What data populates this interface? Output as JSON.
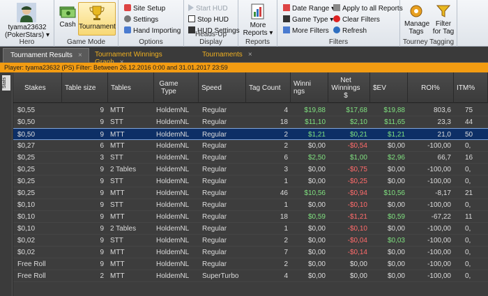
{
  "ribbon": {
    "hero": {
      "name": "tyama23632",
      "site": "(PokerStars)",
      "group_label": "Hero"
    },
    "game_mode": {
      "cash_label": "Cash",
      "tournament_label": "Tournament",
      "group_label": "Game Mode"
    },
    "options": {
      "site_setup": "Site Setup",
      "settings": "Settings",
      "hand_importing": "Hand Importing",
      "group_label": "Options"
    },
    "hud": {
      "start_hud": "Start HUD",
      "stop_hud": "Stop HUD",
      "hud_settings": "HUD Settings",
      "group_label": "Heads-Up Display"
    },
    "reports": {
      "more_reports": "More Reports",
      "group_label": "Reports"
    },
    "filters": {
      "date_range": "Date Range",
      "game_type": "Game Type",
      "more_filters": "More Filters",
      "apply_all": "Apply to all Reports",
      "clear_filters": "Clear Filters",
      "refresh": "Refresh",
      "group_label": "Filters"
    },
    "tagging": {
      "manage_tags": "Manage Tags",
      "filter_for_tag": "Filter for Tag",
      "group_label": "Tourney Tagging"
    }
  },
  "tabs": [
    {
      "label": "Tournament Results"
    },
    {
      "label": "Tournament Winnings Graph"
    },
    {
      "label": "Tournaments"
    }
  ],
  "filter_bar": "Player: tyama23632 (PS)  Filter: Between 26.12.2016 0:00 and 31.01.2017 23:59",
  "side_tab": "Stats",
  "columns": [
    "Stakes",
    "Table size",
    "Tables",
    "Game Type",
    "Speed",
    "Tag Count",
    "Winnings",
    "Net Winnings $",
    "$EV",
    "ROI%",
    "ITM%"
  ],
  "rows": [
    {
      "stakes": "$0,55",
      "size": "9",
      "tables": "MTT",
      "game": "HoldemNL",
      "speed": "Regular",
      "tags": "4",
      "win": "$19,88",
      "net": "$17,68",
      "ev": "$19,88",
      "roi": "803,6",
      "itm": "75"
    },
    {
      "stakes": "$0,50",
      "size": "9",
      "tables": "STT",
      "game": "HoldemNL",
      "speed": "Regular",
      "tags": "18",
      "win": "$11,10",
      "net": "$2,10",
      "ev": "$11,65",
      "roi": "23,3",
      "itm": "44"
    },
    {
      "stakes": "$0,50",
      "size": "9",
      "tables": "MTT",
      "game": "HoldemNL",
      "speed": "Regular",
      "tags": "2",
      "win": "$1,21",
      "net": "$0,21",
      "ev": "$1,21",
      "roi": "21,0",
      "itm": "50"
    },
    {
      "stakes": "$0,27",
      "size": "6",
      "tables": "MTT",
      "game": "HoldemNL",
      "speed": "Regular",
      "tags": "2",
      "win": "$0,00",
      "net": "-$0,54",
      "ev": "$0,00",
      "roi": "-100,00",
      "itm": "0,"
    },
    {
      "stakes": "$0,25",
      "size": "3",
      "tables": "STT",
      "game": "HoldemNL",
      "speed": "Regular",
      "tags": "6",
      "win": "$2,50",
      "net": "$1,00",
      "ev": "$2,96",
      "roi": "66,7",
      "itm": "16"
    },
    {
      "stakes": "$0,25",
      "size": "9",
      "tables": "2 Tables",
      "game": "HoldemNL",
      "speed": "Regular",
      "tags": "3",
      "win": "$0,00",
      "net": "-$0,75",
      "ev": "$0,00",
      "roi": "-100,00",
      "itm": "0,"
    },
    {
      "stakes": "$0,25",
      "size": "9",
      "tables": "STT",
      "game": "HoldemNL",
      "speed": "Regular",
      "tags": "1",
      "win": "$0,00",
      "net": "-$0,25",
      "ev": "$0,00",
      "roi": "-100,00",
      "itm": "0,"
    },
    {
      "stakes": "$0,25",
      "size": "9",
      "tables": "MTT",
      "game": "HoldemNL",
      "speed": "Regular",
      "tags": "46",
      "win": "$10,56",
      "net": "-$0,94",
      "ev": "$10,56",
      "roi": "-8,17",
      "itm": "21"
    },
    {
      "stakes": "$0,10",
      "size": "9",
      "tables": "STT",
      "game": "HoldemNL",
      "speed": "Regular",
      "tags": "1",
      "win": "$0,00",
      "net": "-$0,10",
      "ev": "$0,00",
      "roi": "-100,00",
      "itm": "0,"
    },
    {
      "stakes": "$0,10",
      "size": "9",
      "tables": "MTT",
      "game": "HoldemNL",
      "speed": "Regular",
      "tags": "18",
      "win": "$0,59",
      "net": "-$1,21",
      "ev": "$0,59",
      "roi": "-67,22",
      "itm": "11"
    },
    {
      "stakes": "$0,10",
      "size": "9",
      "tables": "2 Tables",
      "game": "HoldemNL",
      "speed": "Regular",
      "tags": "1",
      "win": "$0,00",
      "net": "-$0,10",
      "ev": "$0,00",
      "roi": "-100,00",
      "itm": "0,"
    },
    {
      "stakes": "$0,02",
      "size": "9",
      "tables": "STT",
      "game": "HoldemNL",
      "speed": "Regular",
      "tags": "2",
      "win": "$0,00",
      "net": "-$0,04",
      "ev": "$0,03",
      "roi": "-100,00",
      "itm": "0,"
    },
    {
      "stakes": "$0,02",
      "size": "9",
      "tables": "MTT",
      "game": "HoldemNL",
      "speed": "Regular",
      "tags": "7",
      "win": "$0,00",
      "net": "-$0,14",
      "ev": "$0,00",
      "roi": "-100,00",
      "itm": "0,"
    },
    {
      "stakes": "Free Roll",
      "size": "9",
      "tables": "MTT",
      "game": "HoldemNL",
      "speed": "Regular",
      "tags": "2",
      "win": "$0,00",
      "net": "$0,00",
      "ev": "$0,00",
      "roi": "-100,00",
      "itm": "0,"
    },
    {
      "stakes": "Free Roll",
      "size": "2",
      "tables": "MTT",
      "game": "HoldemNL",
      "speed": "SuperTurbo",
      "tags": "4",
      "win": "$0,00",
      "net": "$0,00",
      "ev": "$0,00",
      "roi": "-100,00",
      "itm": "0,"
    }
  ]
}
